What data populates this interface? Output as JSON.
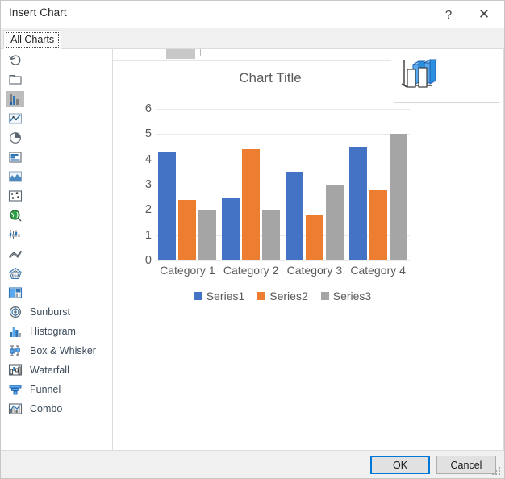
{
  "window": {
    "title": "Insert Chart",
    "help_label": "?",
    "close_label": "✕"
  },
  "tabs": [
    {
      "label": "All Charts",
      "selected": true
    }
  ],
  "type_list": [
    {
      "icon": "recent-icon",
      "label": "",
      "selected": false
    },
    {
      "icon": "templates-icon",
      "label": "",
      "selected": false
    },
    {
      "icon": "column-chart-icon",
      "label": "",
      "selected": true
    },
    {
      "icon": "line-chart-icon",
      "label": "",
      "selected": false
    },
    {
      "icon": "pie-chart-icon",
      "label": "",
      "selected": false
    },
    {
      "icon": "bar-chart-icon",
      "label": "",
      "selected": false
    },
    {
      "icon": "area-chart-icon",
      "label": "",
      "selected": false
    },
    {
      "icon": "scatter-chart-icon",
      "label": "",
      "selected": false
    },
    {
      "icon": "map-chart-icon",
      "label": "",
      "selected": false
    },
    {
      "icon": "stock-chart-icon",
      "label": "",
      "selected": false
    },
    {
      "icon": "surface-chart-icon",
      "label": "",
      "selected": false
    },
    {
      "icon": "radar-chart-icon",
      "label": "",
      "selected": false
    },
    {
      "icon": "treemap-chart-icon",
      "label": "",
      "selected": false
    },
    {
      "icon": "sunburst-chart-icon",
      "label": "Sunburst",
      "selected": false
    },
    {
      "icon": "histogram-chart-icon",
      "label": "Histogram",
      "selected": false
    },
    {
      "icon": "boxwhisker-chart-icon",
      "label": "Box & Whisker",
      "selected": false
    },
    {
      "icon": "waterfall-chart-icon",
      "label": "Waterfall",
      "selected": false
    },
    {
      "icon": "funnel-chart-icon",
      "label": "Funnel",
      "selected": false
    },
    {
      "icon": "combo-chart-icon",
      "label": "Combo",
      "selected": false
    }
  ],
  "subtypes": {
    "count": 7,
    "selected_index": 1
  },
  "preview": {
    "type_icon": "3d-column-chart-icon"
  },
  "footer": {
    "ok_label": "OK",
    "cancel_label": "Cancel"
  },
  "colors": {
    "series1": "#4472C4",
    "series2": "#ED7D31",
    "series3": "#A5A5A5",
    "accent_focus": "#0078D7",
    "gridline": "#EAEAEA",
    "chart_text": "#5A5A5A"
  },
  "chart_data": {
    "type": "bar",
    "title": "Chart Title",
    "xlabel": "",
    "ylabel": "",
    "ylim": [
      0,
      6
    ],
    "yticks": [
      0,
      1,
      2,
      3,
      4,
      5,
      6
    ],
    "grid": true,
    "legend_position": "bottom",
    "categories": [
      "Category 1",
      "Category 2",
      "Category 3",
      "Category 4"
    ],
    "series": [
      {
        "name": "Series1",
        "color": "#4472C4",
        "values": [
          4.3,
          2.5,
          3.5,
          4.5
        ]
      },
      {
        "name": "Series2",
        "color": "#ED7D31",
        "values": [
          2.4,
          4.4,
          1.8,
          2.8
        ]
      },
      {
        "name": "Series3",
        "color": "#A5A5A5",
        "values": [
          2.0,
          2.0,
          3.0,
          5.0
        ]
      }
    ]
  }
}
